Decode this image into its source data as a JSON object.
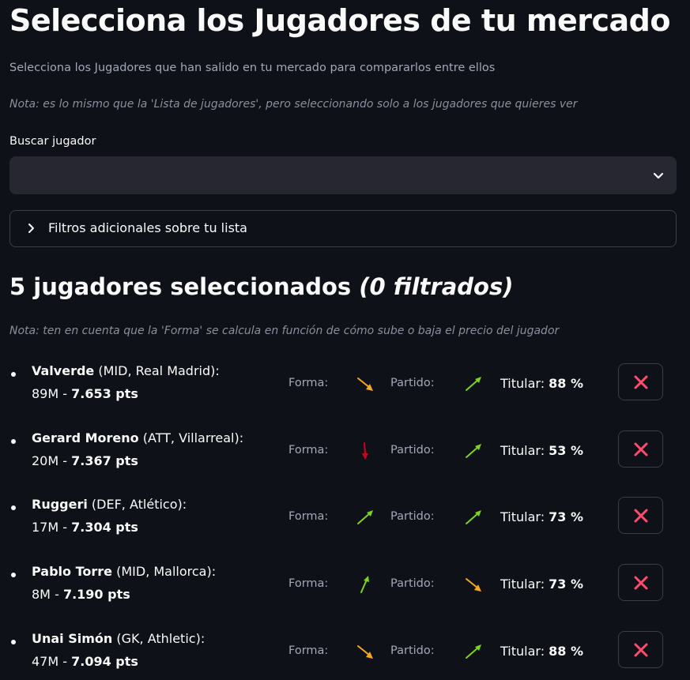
{
  "page": {
    "title": "Selecciona los Jugadores de tu mercado",
    "subtitle": "Selecciona los Jugadores que han salido en tu mercado para compararlos entre ellos",
    "note": "Nota: es lo mismo que la 'Lista de jugadores', pero seleccionando solo a los jugadores que quieres ver"
  },
  "search": {
    "label": "Buscar jugador",
    "value": "",
    "icon": "chevron-down-icon"
  },
  "expander": {
    "label": "Filtros adicionales sobre tu lista",
    "icon": "chevron-right-icon"
  },
  "summary": {
    "count_text": "5 jugadores seleccionados",
    "filtered_text": "(0 filtrados)",
    "note": "Nota: ten en cuenta que la 'Forma' se calcula en función de cómo sube o baja el precio del jugador"
  },
  "labels": {
    "forma": "Forma:",
    "partido": "Partido:",
    "titular": "Titular:"
  },
  "colors": {
    "background": "#0e1117",
    "up": "#7ed321",
    "down_orange": "#f5a623",
    "down_red": "#d0021b",
    "delete": "#ff4b6e"
  },
  "players": [
    {
      "name": "Valverde",
      "info": " (MID, Real Madrid):",
      "price": "89M - ",
      "points": "7.653 pts",
      "forma": "down-orange",
      "partido": "up",
      "titular": "88 %"
    },
    {
      "name": "Gerard Moreno",
      "info": " (ATT, Villarreal):",
      "price": "20M - ",
      "points": "7.367 pts",
      "forma": "down-red",
      "partido": "up",
      "titular": "53 %"
    },
    {
      "name": "Ruggeri",
      "info": " (DEF, Atlético):",
      "price": "17M - ",
      "points": "7.304 pts",
      "forma": "up",
      "partido": "up",
      "titular": "73 %"
    },
    {
      "name": "Pablo Torre",
      "info": " (MID, Mallorca):",
      "price": "8M - ",
      "points": "7.190 pts",
      "forma": "up-steep",
      "partido": "down-orange",
      "titular": "73 %"
    },
    {
      "name": "Unai Simón",
      "info": " (GK, Athletic):",
      "price": "47M - ",
      "points": "7.094 pts",
      "forma": "down-orange",
      "partido": "up",
      "titular": "88 %"
    }
  ]
}
